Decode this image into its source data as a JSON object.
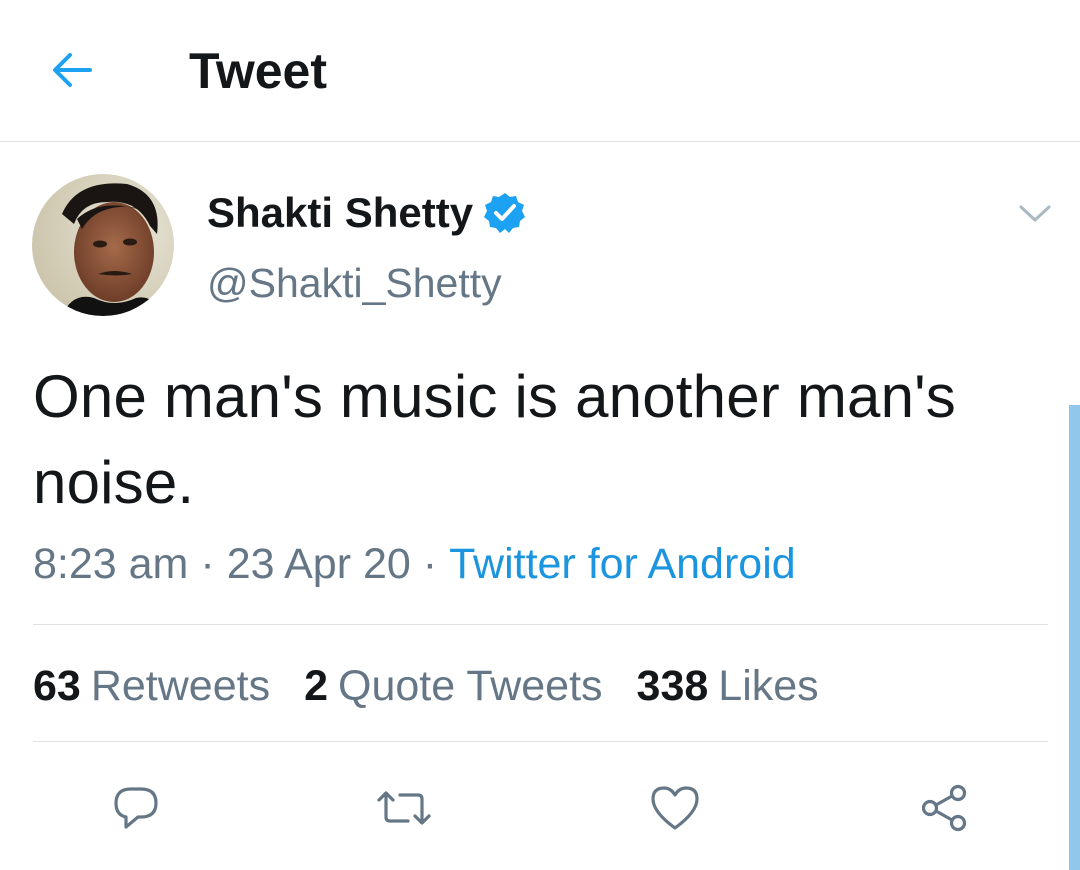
{
  "header": {
    "title": "Tweet",
    "back_icon": "back-arrow-icon"
  },
  "author": {
    "display_name": "Shakti Shetty",
    "handle": "@Shakti_Shetty",
    "verified": true
  },
  "tweet": {
    "text": "One man's music is another man's noise.",
    "time": "8:23 am",
    "date": "23 Apr 20",
    "separator": "·",
    "source": "Twitter for Android"
  },
  "stats": [
    {
      "count": "63",
      "label": "Retweets"
    },
    {
      "count": "2",
      "label": "Quote Tweets"
    },
    {
      "count": "338",
      "label": "Likes"
    }
  ],
  "actions": {
    "reply_icon": "reply-icon",
    "retweet_icon": "retweet-icon",
    "like_icon": "heart-icon",
    "share_icon": "share-icon"
  },
  "colors": {
    "accent": "#1da1f2",
    "link": "#1b95e0",
    "text_primary": "#14171a",
    "text_secondary": "#657786",
    "divider": "#dfe3e6"
  }
}
